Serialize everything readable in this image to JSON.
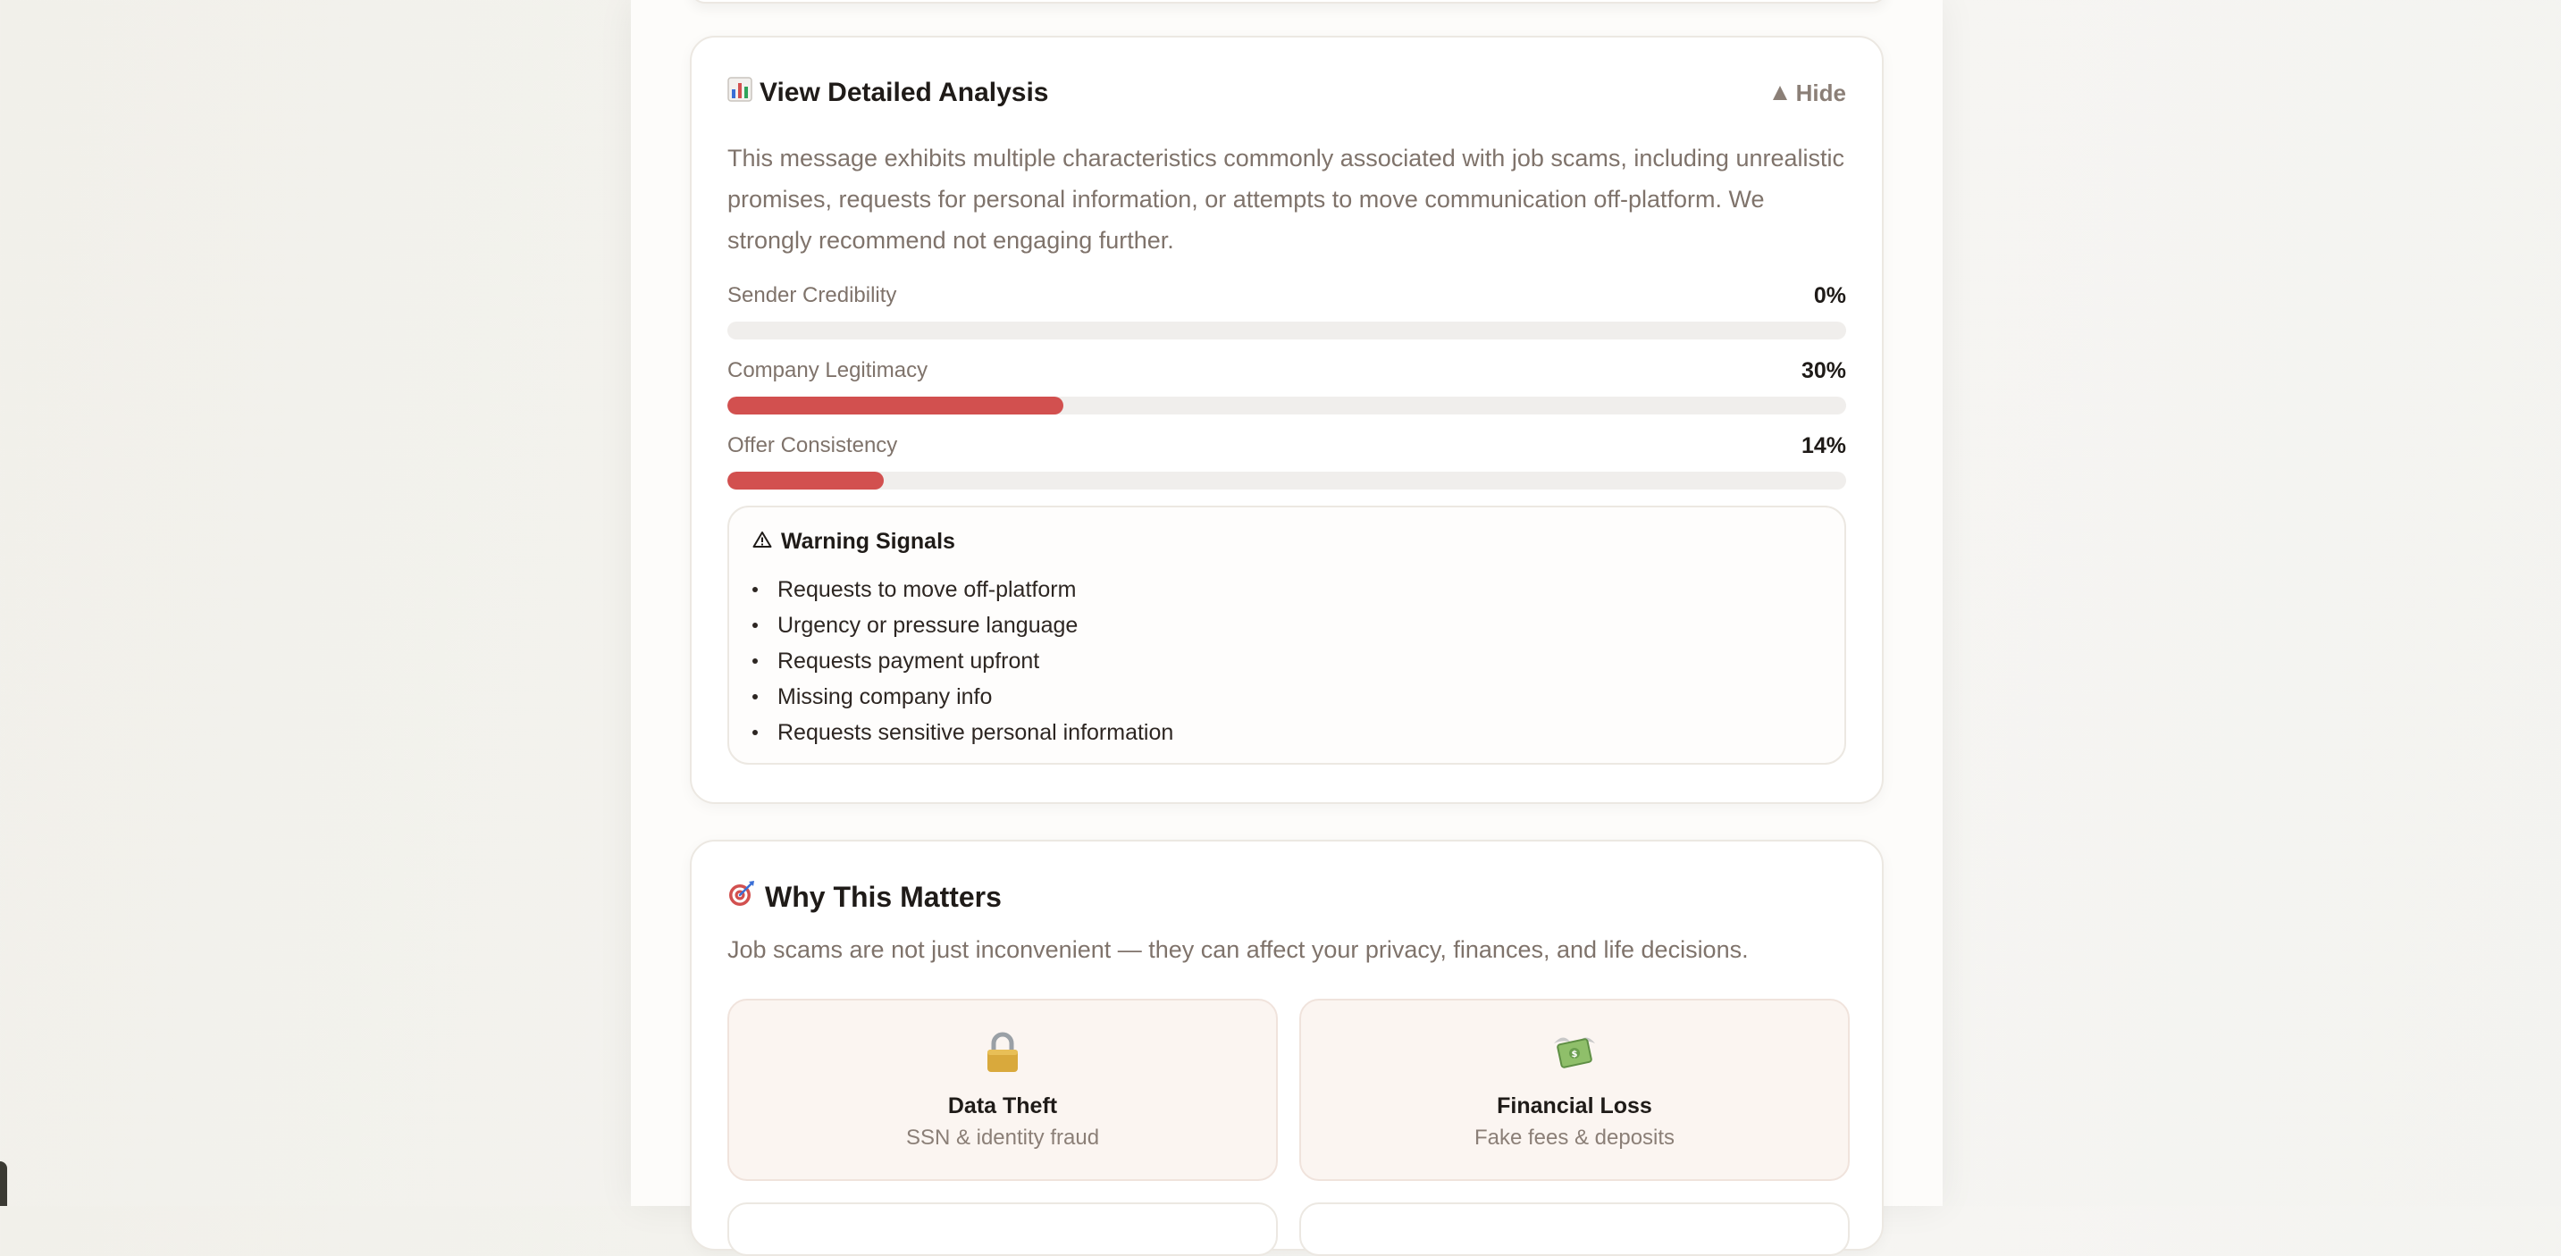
{
  "analysis": {
    "title": "View Detailed Analysis",
    "title_icon": "bar-chart-icon",
    "toggle_label": "Hide",
    "summary": "This message exhibits multiple characteristics commonly associated with job scams, including unrealistic promises, requests for personal information, or attempts to move communication off-platform. We strongly recommend not engaging further.",
    "metrics": [
      {
        "label": "Sender Credibility",
        "value_text": "0%",
        "value": 0
      },
      {
        "label": "Company Legitimacy",
        "value_text": "30%",
        "value": 30
      },
      {
        "label": "Offer Consistency",
        "value_text": "14%",
        "value": 14
      }
    ],
    "bar_color": "#d2504f",
    "warnings": {
      "title": "Warning Signals",
      "icon": "warning-triangle-icon",
      "items": [
        "Requests to move off-platform",
        "Urgency or pressure language",
        "Requests payment upfront",
        "Missing company info",
        "Requests sensitive personal information"
      ]
    }
  },
  "matters": {
    "title": "Why This Matters",
    "title_icon": "target-icon",
    "subtitle": "Job scams are not just inconvenient — they can affect your privacy, finances, and life decisions.",
    "impacts": [
      {
        "title": "Data Theft",
        "desc": "SSN & identity fraud",
        "icon": "lock-icon"
      },
      {
        "title": "Financial Loss",
        "desc": "Fake fees & deposits",
        "icon": "money-with-wings-icon"
      }
    ]
  }
}
